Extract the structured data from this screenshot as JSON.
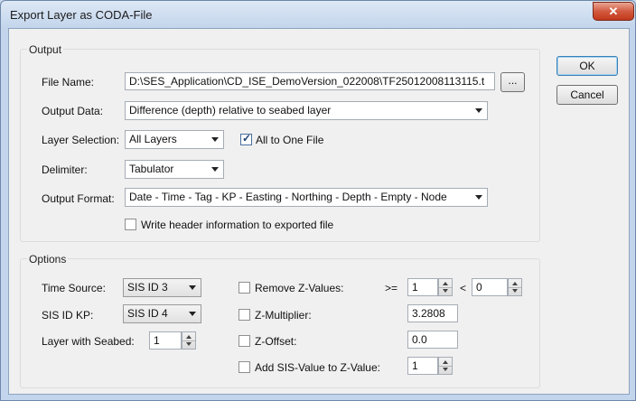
{
  "window": {
    "title": "Export Layer as CODA-File",
    "close_glyph": "✕"
  },
  "buttons": {
    "ok": "OK",
    "cancel": "Cancel",
    "browse": "..."
  },
  "output": {
    "legend": "Output",
    "file_name_label": "File Name:",
    "file_name_value": "D:\\SES_Application\\CD_ISE_DemoVersion_022008\\TF25012008113115.t",
    "output_data_label": "Output Data:",
    "output_data_value": "Difference (depth) relative to seabed layer",
    "layer_selection_label": "Layer Selection:",
    "layer_selection_value": "All Layers",
    "all_to_one_file_label": "All to One File",
    "all_to_one_file_checked": true,
    "delimiter_label": "Delimiter:",
    "delimiter_value": "Tabulator",
    "output_format_label": "Output Format:",
    "output_format_value": "Date - Time - Tag - KP - Easting - Northing - Depth - Empty - Node",
    "write_header_label": "Write header information to exported file",
    "write_header_checked": false
  },
  "options": {
    "legend": "Options",
    "time_source_label": "Time Source:",
    "time_source_value": "SIS ID 3",
    "sis_id_kp_label": "SIS ID KP:",
    "sis_id_kp_value": "SIS ID 4",
    "layer_with_seabed_label": "Layer with Seabed:",
    "layer_with_seabed_value": "1",
    "remove_z_label": "Remove Z-Values:",
    "remove_z_checked": false,
    "ge_symbol": ">=",
    "lt_symbol": "<",
    "remove_z_min": "1",
    "remove_z_max": "0",
    "z_multiplier_label": "Z-Multiplier:",
    "z_multiplier_checked": false,
    "z_multiplier_value": "3.2808",
    "z_offset_label": "Z-Offset:",
    "z_offset_checked": false,
    "z_offset_value": "0.0",
    "add_sis_label": "Add SIS-Value to  Z-Value:",
    "add_sis_checked": false,
    "add_sis_value": "1"
  }
}
